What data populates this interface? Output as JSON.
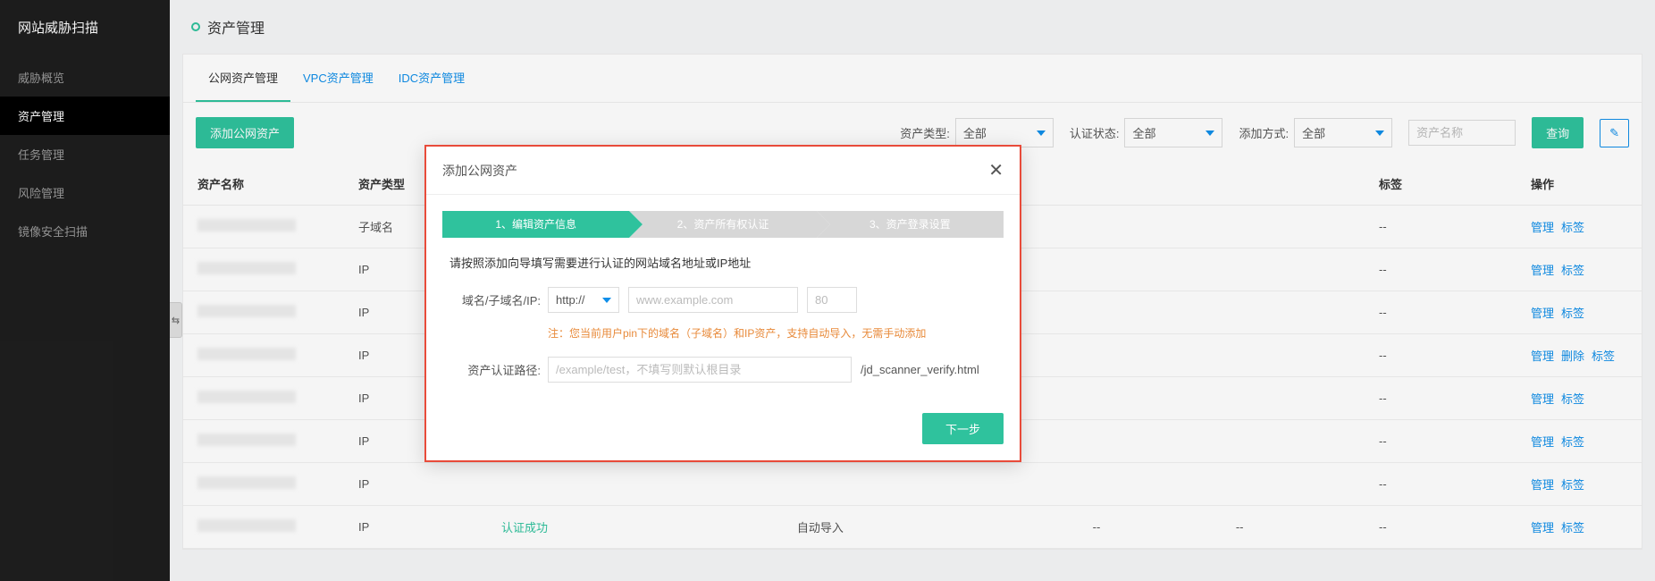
{
  "sidebar": {
    "title": "网站威胁扫描",
    "items": [
      {
        "label": "威胁概览"
      },
      {
        "label": "资产管理",
        "active": true
      },
      {
        "label": "任务管理"
      },
      {
        "label": "风险管理"
      },
      {
        "label": "镜像安全扫描"
      }
    ]
  },
  "header": {
    "title": "资产管理"
  },
  "tabs": [
    {
      "label": "公网资产管理",
      "active": true
    },
    {
      "label": "VPC资产管理"
    },
    {
      "label": "IDC资产管理"
    }
  ],
  "toolbar": {
    "add_btn": "添加公网资产",
    "filters": {
      "asset_type": {
        "label": "资产类型:",
        "value": "全部"
      },
      "cert_status": {
        "label": "认证状态:",
        "value": "全部"
      },
      "add_method": {
        "label": "添加方式:",
        "value": "全部"
      }
    },
    "search_placeholder": "资产名称",
    "search_btn": "查询",
    "edit_icon": "edit"
  },
  "table": {
    "headers": [
      "资产名称",
      "资产类型",
      "标签",
      "操作"
    ],
    "other_cols_visible": [
      "标签",
      "操作"
    ],
    "rows": [
      {
        "type": "子域名",
        "tag": "--",
        "actions": [
          "管理",
          "标签"
        ]
      },
      {
        "type": "IP",
        "tag": "--",
        "actions": [
          "管理",
          "标签"
        ]
      },
      {
        "type": "IP",
        "tag": "--",
        "actions": [
          "管理",
          "标签"
        ]
      },
      {
        "type": "IP",
        "tag": "--",
        "actions": [
          "管理",
          "删除",
          "标签"
        ]
      },
      {
        "type": "IP",
        "tag": "--",
        "actions": [
          "管理",
          "标签"
        ]
      },
      {
        "type": "IP",
        "tag": "--",
        "actions": [
          "管理",
          "标签"
        ]
      },
      {
        "type": "IP",
        "tag": "--",
        "actions": [
          "管理",
          "标签"
        ]
      },
      {
        "type": "IP",
        "cert": "认证成功",
        "method": "自动导入",
        "c1": "--",
        "c2": "--",
        "tag": "--",
        "actions": [
          "管理",
          "标签"
        ]
      }
    ]
  },
  "modal": {
    "title": "添加公网资产",
    "steps": [
      "1、编辑资产信息",
      "2、资产所有权认证",
      "3、资产登录设置"
    ],
    "active_step": 0,
    "hint": "请按照添加向导填写需要进行认证的网站域名地址或IP地址",
    "f_domain_label": "域名/子域名/IP:",
    "proto_value": "http://",
    "domain_placeholder": "www.example.com",
    "port_placeholder": "80",
    "warn": "注：您当前用户pin下的域名（子域名）和IP资产，支持自动导入，无需手动添加",
    "f_path_label": "资产认证路径:",
    "path_placeholder": "/example/test，不填写则默认根目录",
    "path_suffix": "/jd_scanner_verify.html",
    "next_btn": "下一步"
  }
}
